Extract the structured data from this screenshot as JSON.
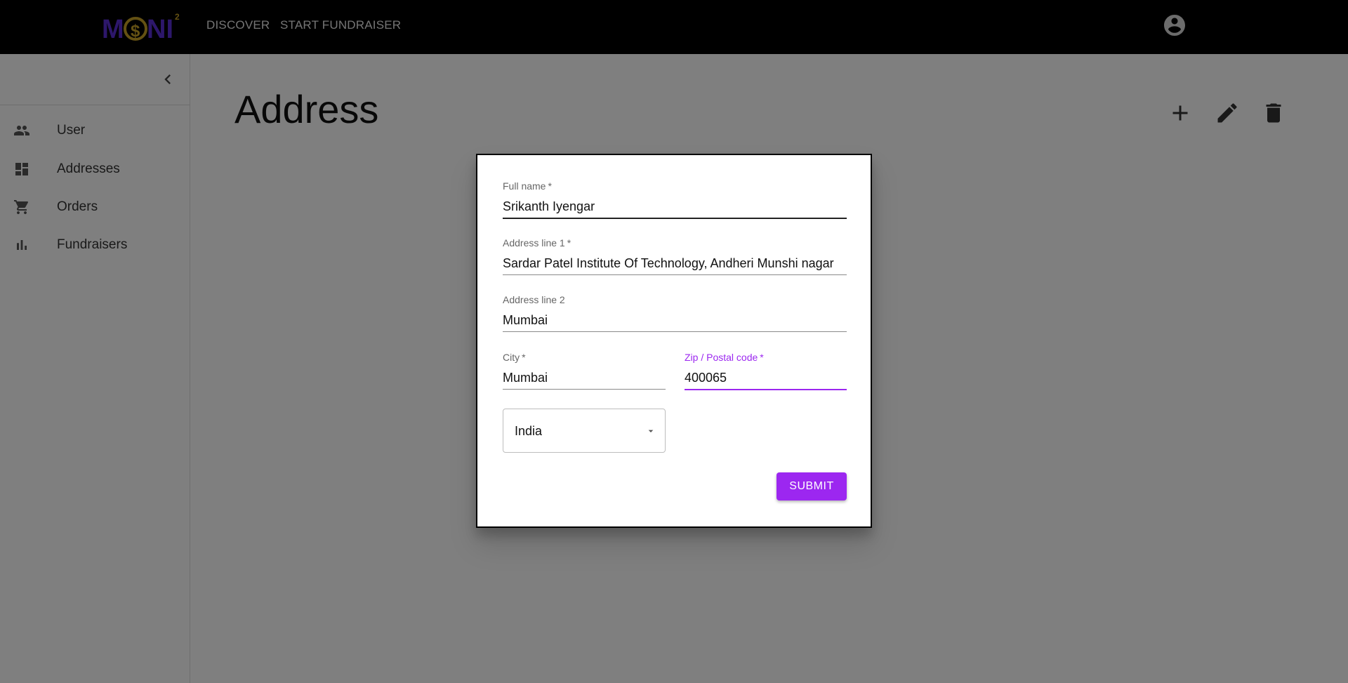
{
  "app": {
    "logo_text": "MONI",
    "logo_superscript": "2",
    "nav": [
      {
        "label": "DISCOVER"
      },
      {
        "label": "START FUNDRAISER"
      }
    ],
    "account_icon": "account-circle-icon"
  },
  "sidebar": {
    "collapse_icon": "chevron-left-icon",
    "items": [
      {
        "label": "User",
        "icon": "people-icon"
      },
      {
        "label": "Addresses",
        "icon": "dashboard-icon"
      },
      {
        "label": "Orders",
        "icon": "shopping-cart-icon"
      },
      {
        "label": "Fundraisers",
        "icon": "bar-chart-icon"
      }
    ]
  },
  "page": {
    "title": "Address",
    "toolbar_icons": [
      "add-icon",
      "edit-icon",
      "delete-icon"
    ]
  },
  "form": {
    "full_name": {
      "label": "Full name",
      "required": "*",
      "value": "Srikanth Iyengar"
    },
    "address_line_1": {
      "label": "Address line 1",
      "required": "*",
      "value": "Sardar Patel Institute Of Technology, Andheri Munshi nagar"
    },
    "address_line_2": {
      "label": "Address line 2",
      "value": "Mumbai"
    },
    "city": {
      "label": "City",
      "required": "*",
      "value": "Mumbai"
    },
    "zip": {
      "label": "Zip / Postal code",
      "required": "*",
      "value": "400065"
    },
    "country": {
      "value": "India"
    },
    "submit_label": "SUBMIT"
  },
  "colors": {
    "accent": "#9c27f0",
    "topbar": "#000000",
    "logo_purple": "#5b2fd6",
    "logo_gold": "#c9a227"
  }
}
